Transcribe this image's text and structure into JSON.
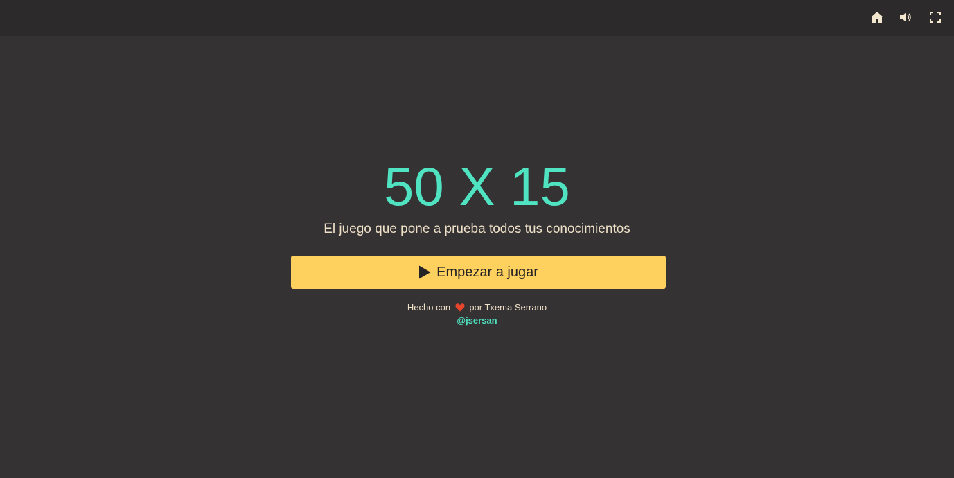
{
  "topbar": {
    "icons": [
      "home-icon",
      "volume-icon",
      "fullscreen-icon"
    ]
  },
  "game": {
    "title": "50 X 15",
    "subtitle": "El juego que pone a prueba todos tus conocimientos",
    "play_label": "Empezar a jugar"
  },
  "credits": {
    "made_with": "Hecho con",
    "by_author": "por Txema Serrano",
    "handle": "@jsersan"
  },
  "colors": {
    "background": "#343233",
    "topbar": "#2c2a2b",
    "accent": "#4fe3c1",
    "button": "#fed05e",
    "text": "#efe0c8",
    "heart": "#e8452c"
  }
}
